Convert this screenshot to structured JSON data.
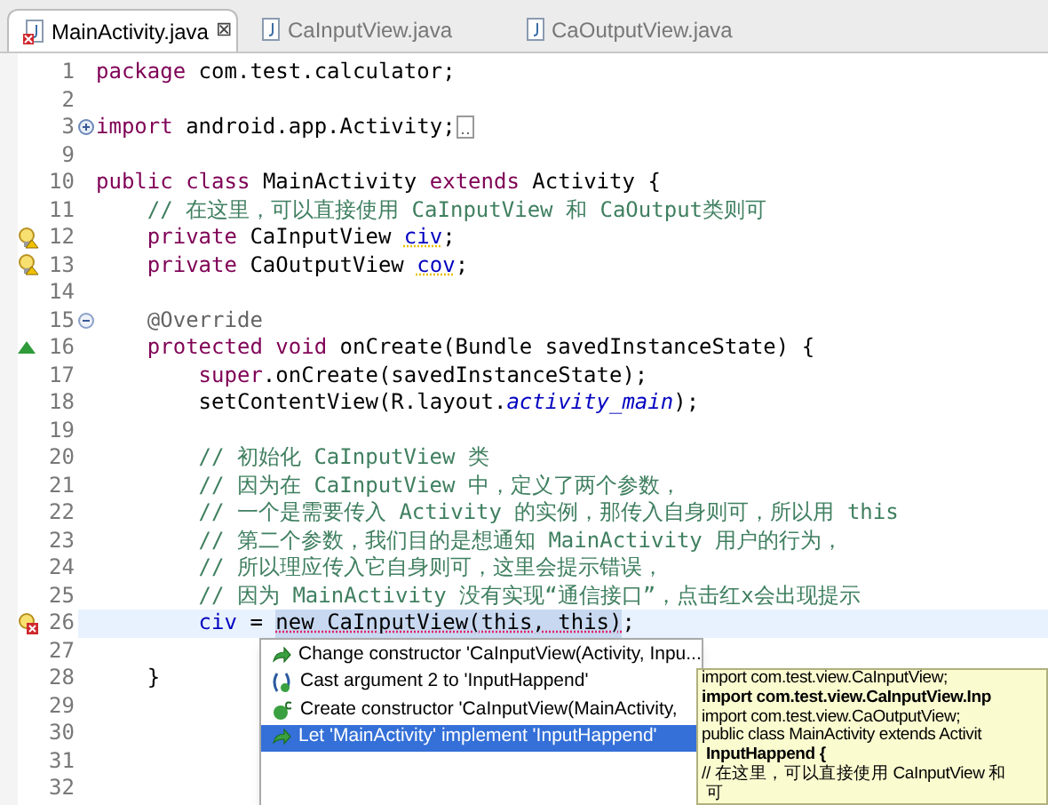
{
  "tabs": [
    {
      "label": "MainActivity.java",
      "selected": true,
      "has_error": true,
      "close": "⊠"
    },
    {
      "label": "CaInputView.java",
      "selected": false,
      "has_error": false
    },
    {
      "label": "CaOutputView.java",
      "selected": false,
      "has_error": false
    }
  ],
  "lines": [
    {
      "number": "1",
      "current": false,
      "tokens": [
        {
          "text": "package",
          "kind": "keyword"
        },
        {
          "text": " com.test.calculator;",
          "kind": "plain"
        }
      ]
    },
    {
      "number": "2",
      "current": false
    },
    {
      "number": "3",
      "kind": "expandable",
      "current": false,
      "tokens": [
        {
          "text": "import",
          "kind": "keyword"
        },
        {
          "text": " android.app.Activity;",
          "kind": "plain"
        }
      ]
    },
    {
      "number": "9",
      "current": false
    },
    {
      "number": "10",
      "current": false,
      "tokens": [
        {
          "text": "public",
          "kind": "keyword"
        },
        {
          "text": " class",
          "kind": "keyword"
        },
        {
          "text": " MainActivity ",
          "kind": "plain"
        },
        {
          "text": "extends",
          "kind": "keyword"
        },
        {
          "text": " Activity {",
          "kind": "plain"
        }
      ]
    },
    {
      "number": "11",
      "current": false,
      "tokens": [
        {
          "text": "    // 在这里，可以直接使用 CaInputView 和 CaOutput类则可",
          "kind": "comment"
        }
      ]
    },
    {
      "number": "12",
      "kind": "warning",
      "current": false,
      "tokens": [
        {
          "text": "    private",
          "kind": "keyword"
        },
        {
          "text": " CaInputView ",
          "kind": "plain"
        },
        {
          "text": "civ",
          "kind": "field_warning"
        },
        {
          "text": ";",
          "kind": "plain"
        }
      ]
    },
    {
      "number": "13",
      "kind": "warning",
      "current": false,
      "tokens": [
        {
          "text": "    private",
          "kind": "keyword"
        },
        {
          "text": " CaOutputView ",
          "kind": "plain"
        },
        {
          "text": "cov",
          "kind": "field_warning"
        },
        {
          "text": ";",
          "kind": "plain"
        }
      ]
    },
    {
      "number": "14",
      "current": false
    },
    {
      "number": "15",
      "kind": "collapsible",
      "current": false,
      "tokens": [
        {
          "text": "    @Override",
          "kind": "annotation"
        }
      ]
    },
    {
      "number": "16",
      "kind": "override",
      "current": false,
      "tokens": [
        {
          "text": "    protected",
          "kind": "keyword"
        },
        {
          "text": " void",
          "kind": "keyword"
        },
        {
          "text": " onCreate(Bundle savedInstanceState) {",
          "kind": "plain"
        }
      ]
    },
    {
      "number": "17",
      "current": false,
      "tokens": [
        {
          "text": "        super",
          "kind": "keyword"
        },
        {
          "text": ".onCreate(savedInstanceState);",
          "kind": "plain"
        }
      ]
    },
    {
      "number": "18",
      "current": false,
      "tokens": [
        {
          "text": "        setContentView(R.layout.",
          "kind": "plain"
        },
        {
          "text": "activity_main",
          "kind": "constant"
        },
        {
          "text": ");",
          "kind": "plain"
        }
      ]
    },
    {
      "number": "19",
      "current": false
    },
    {
      "number": "20",
      "current": false,
      "tokens": [
        {
          "text": "        // 初始化 CaInputView 类",
          "kind": "comment"
        }
      ]
    },
    {
      "number": "21",
      "current": false,
      "tokens": [
        {
          "text": "        // 因为在 CaInputView 中，定义了两个参数，",
          "kind": "comment"
        }
      ]
    },
    {
      "number": "22",
      "current": false,
      "tokens": [
        {
          "text": "        // 一个是需要传入 Activity 的实例，那传入自身则可，所以用 this",
          "kind": "comment"
        }
      ]
    },
    {
      "number": "23",
      "current": false,
      "tokens": [
        {
          "text": "        // 第二个参数，我们目的是想通知 MainActivity 用户的行为，",
          "kind": "comment"
        }
      ]
    },
    {
      "number": "24",
      "current": false,
      "tokens": [
        {
          "text": "        // 所以理应传入它自身则可，这里会提示错误，",
          "kind": "comment"
        }
      ]
    },
    {
      "number": "25",
      "current": false,
      "tokens": [
        {
          "text": "        // 因为 MainActivity 没有实现“通信接口”，点击红x会出现提示",
          "kind": "comment"
        }
      ]
    },
    {
      "number": "26",
      "kind": "error",
      "current": true,
      "tokens": [
        {
          "text": "        civ",
          "kind": "field"
        },
        {
          "text": " = ",
          "kind": "plain"
        },
        {
          "text": "new CaInputView(this, this)",
          "kind": "error"
        },
        {
          "text": ";",
          "kind": "plain"
        }
      ]
    },
    {
      "number": "27",
      "current": false
    },
    {
      "number": "28",
      "current": false,
      "tokens": [
        {
          "text": "    }",
          "kind": "plain"
        }
      ]
    },
    {
      "number": "29",
      "current": false
    },
    {
      "number": "30",
      "current": false
    },
    {
      "number": "31",
      "current": false
    },
    {
      "number": "32",
      "current": false
    }
  ],
  "quick_fixes": [
    {
      "label": "Change constructor 'CaInputView(Activity, Inpu...",
      "kind": "change",
      "selected": false
    },
    {
      "label": "Cast argument 2 to 'InputHappend'",
      "kind": "cast",
      "selected": false
    },
    {
      "label": "Create constructor 'CaInputView(MainActivity,",
      "kind": "create",
      "selected": false
    },
    {
      "label": "Let 'MainActivity' implement 'InputHappend'",
      "kind": "change",
      "selected": true
    }
  ],
  "preview": [
    {
      "text": "import com.test.view.CaInputView;",
      "bold": false
    },
    {
      "text": "import com.test.view.CaInputView.Inp",
      "bold": true
    },
    {
      "text": "import com.test.view.CaOutputView;",
      "bold": false
    },
    {
      "text": "public class MainActivity extends Activit",
      "bold": false
    },
    {
      "text": " InputHappend {",
      "bold": true
    },
    {
      "text": "// 在这里，可以直接使用 CaInputView 和",
      "bold": false
    },
    {
      "text": " 可",
      "bold": false
    }
  ]
}
